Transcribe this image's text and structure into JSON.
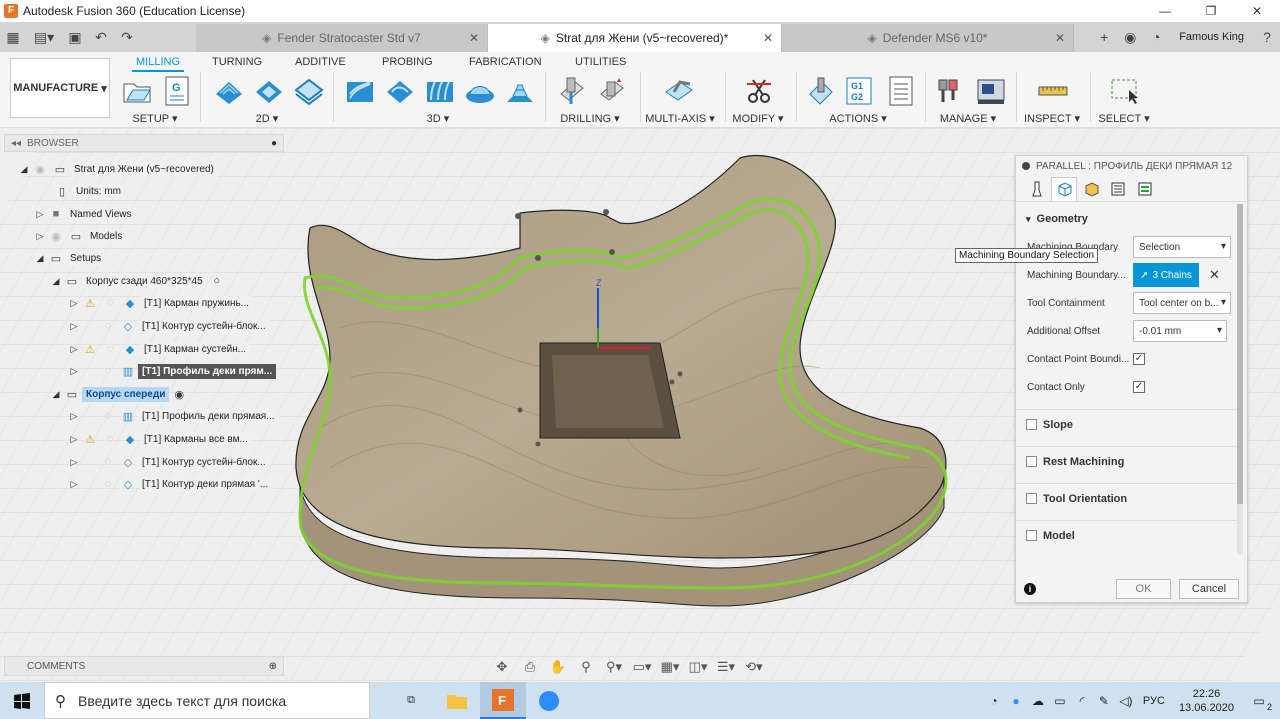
{
  "window": {
    "title": "Autodesk Fusion 360 (Education License)",
    "app_icon": "F"
  },
  "tabs": [
    {
      "label": "Fender Stratocaster Std v7",
      "active": false
    },
    {
      "label": "Strat для Жени (v5~recovered)*",
      "active": true
    },
    {
      "label": "Defender MS6 v10*",
      "active": false
    }
  ],
  "user": {
    "name": "Famous King"
  },
  "ribbon": {
    "workspace": "MANUFACTURE",
    "tabs": [
      "MILLING",
      "TURNING",
      "ADDITIVE",
      "PROBING",
      "FABRICATION",
      "UTILITIES"
    ],
    "groups": [
      "SETUP",
      "2D",
      "3D",
      "DRILLING",
      "MULTI-AXIS",
      "MODIFY",
      "ACTIONS",
      "MANAGE",
      "INSPECT",
      "SELECT"
    ],
    "actions_icon_text": [
      "G1",
      "G2"
    ],
    "setup_icon_text": "G"
  },
  "browser": {
    "header": "BROWSER",
    "root": "Strat для Жени (v5~recovered)",
    "units": "Units: mm",
    "named_views": "Named Views",
    "models": "Models",
    "setups": "Setups",
    "setup1": {
      "name": "Корпус сзади 460*325*45",
      "ops": [
        "[T1] Карман пружинь...",
        "[T1] Контур сустейн-блок...",
        "[T1] Карман сустейн...",
        "[T1] Профиль деки прям..."
      ]
    },
    "setup2": {
      "name": "Корпус спереди",
      "ops": [
        "[T1] Профиль деки прямая...",
        "[T1] Карманы все вм...",
        "[T1] Контур сустейн-блок...",
        "[T1] Контур деки прямая '..."
      ]
    }
  },
  "panel": {
    "title": "PARALLEL : ПРОФИЛЬ ДЕКИ ПРЯМАЯ 12",
    "geometry": "Geometry",
    "rows": [
      {
        "label": "Machining Boundary",
        "value": "Selection"
      },
      {
        "label": "Machining Boundary...",
        "value": "3 Chains"
      },
      {
        "label": "Tool Containment",
        "value": "Tool center on b..."
      },
      {
        "label": "Additional Offset",
        "value": "-0.01 mm"
      },
      {
        "label": "Contact Point Boundi...",
        "checked": true
      },
      {
        "label": "Contact Only",
        "checked": true
      }
    ],
    "sections": [
      "Slope",
      "Rest Machining",
      "Tool Orientation",
      "Model"
    ],
    "ok": "OK",
    "cancel": "Cancel"
  },
  "tooltip": "Machining Boundary Selection",
  "comments": "COMMENTS",
  "taskbar": {
    "search_placeholder": "Введите здесь текст для поиска",
    "lang": "РУС",
    "time": "22:26",
    "date": "13.06.2020",
    "notif": "2"
  },
  "colors": {
    "accent": "#0696d7",
    "toolpath": "#7bd62a",
    "wood": "#b3a38a"
  }
}
